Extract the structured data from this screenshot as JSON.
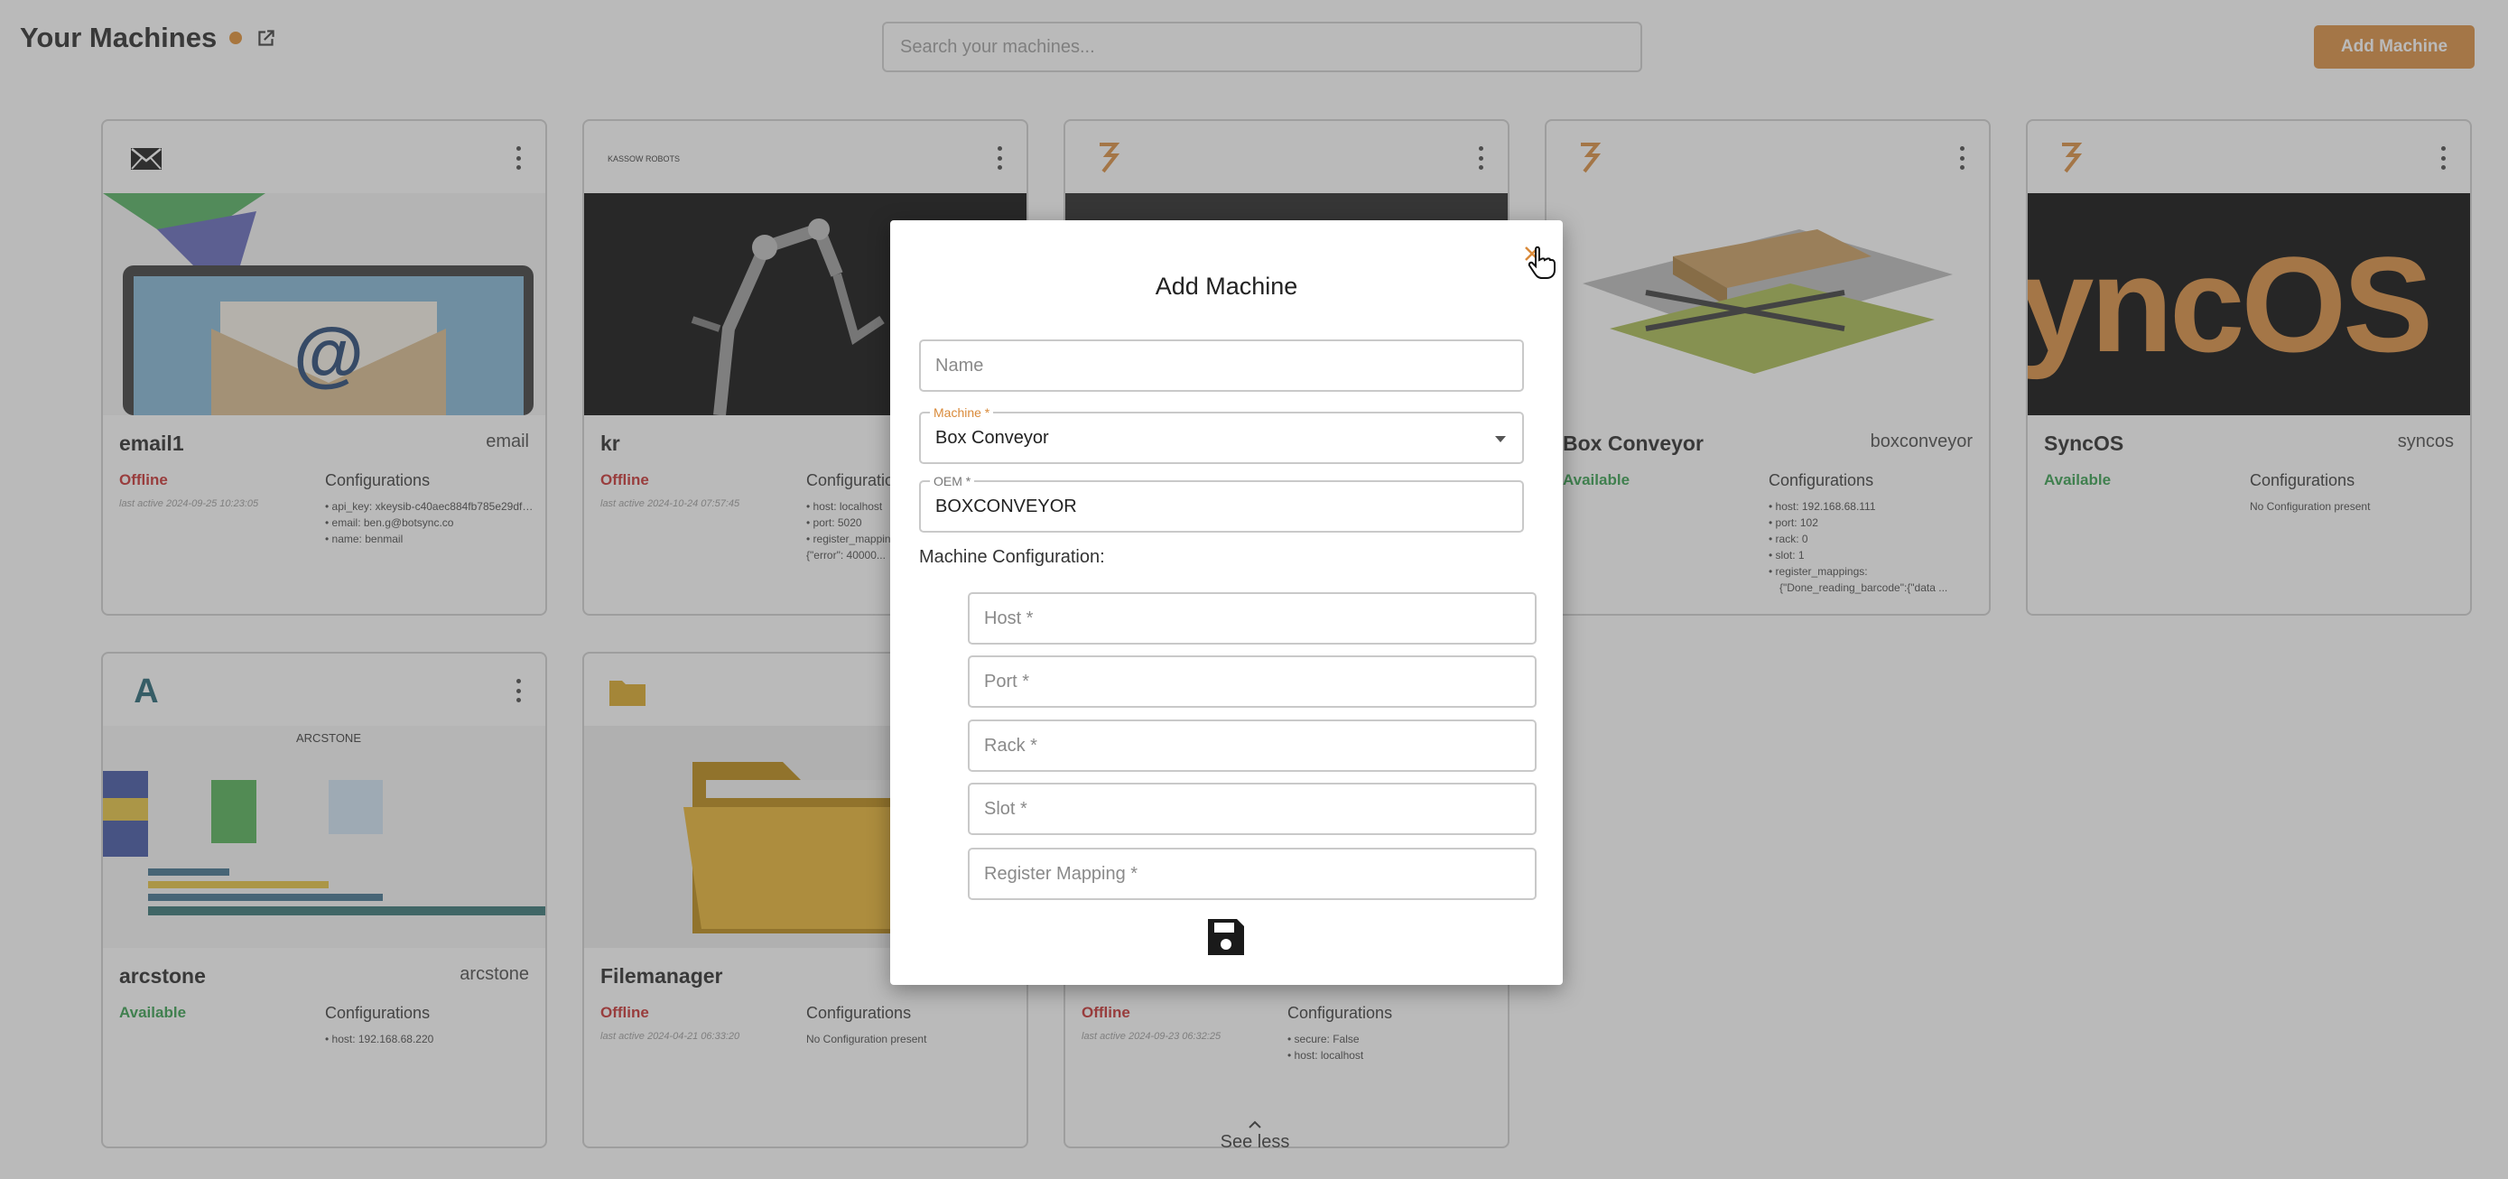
{
  "header": {
    "title": "Your Machines",
    "search_placeholder": "Search your machines...",
    "add_button": "Add Machine"
  },
  "colors": {
    "accent": "#d98a3a",
    "offline": "#c62828",
    "available": "#2e9b47"
  },
  "cards": [
    {
      "name": "email1",
      "type": "email",
      "status": "Offline",
      "last_active": "last active 2024-09-25 10:23:05",
      "config_header": "Configurations",
      "config": [
        "• api_key: xkeysib-c40aec884fb785e29dfa91 ...",
        "• email: ben.g@botsync.co",
        "• name: benmail"
      ],
      "logo": "mail-icon"
    },
    {
      "name": "kr",
      "type": "",
      "status": "Offline",
      "last_active": "last active 2024-10-24 07:57:45",
      "config_header": "Configurations",
      "config": [
        "• host: localhost",
        "• port: 5020",
        "• register_mapping",
        "{\"error\": 40000..."
      ],
      "logo": "kassow-robots-logo",
      "logo_text": "KASSOW ROBOTS"
    },
    {
      "name": "",
      "type": "",
      "status": "",
      "last_active": "",
      "config_header": "",
      "config": [],
      "logo": "botsync-logo"
    },
    {
      "name": "Box Conveyor",
      "type": "boxconveyor",
      "status": "Available",
      "last_active": "",
      "config_header": "Configurations",
      "config": [
        "• host: 192.168.68.111",
        "• port: 102",
        "• rack: 0",
        "• slot: 1",
        "• register_mappings:",
        "{\"Done_reading_barcode\":{\"data ..."
      ],
      "logo": "botsync-logo"
    },
    {
      "name": "SyncOS",
      "type": "syncos",
      "status": "Available",
      "last_active": "",
      "config_header": "Configurations",
      "config": [
        "No Configuration present"
      ],
      "logo": "botsync-logo",
      "image_text": "yncOS"
    },
    {
      "name": "arcstone",
      "type": "arcstone",
      "status": "Available",
      "last_active": "",
      "config_header": "Configurations",
      "config": [
        "• host: 192.168.68.220"
      ],
      "logo": "arcstone-logo",
      "logo_text": "A",
      "image_text": "ARCSTONE"
    },
    {
      "name": "Filemanager",
      "type": "",
      "status": "Offline",
      "last_active": "last active 2024-04-21 06:33:20",
      "config_header": "Configurations",
      "config": [
        "No Configuration present"
      ],
      "logo": "folder-icon"
    },
    {
      "name": "",
      "type": "",
      "status": "Offline",
      "last_active": "last active 2024-09-23 06:32:25",
      "config_header": "Configurations",
      "config": [
        "• secure: False",
        "• host: localhost"
      ],
      "logo": ""
    }
  ],
  "modal": {
    "title": "Add Machine",
    "name_placeholder": "Name",
    "machine_label": "Machine *",
    "machine_value": "Box Conveyor",
    "oem_label": "OEM *",
    "oem_value": "BOXCONVEYOR",
    "section_label": "Machine Configuration:",
    "host_placeholder": "Host *",
    "port_placeholder": "Port *",
    "rack_placeholder": "Rack *",
    "slot_placeholder": "Slot *",
    "register_placeholder": "Register Mapping *"
  },
  "footer": {
    "see_less": "See less"
  }
}
